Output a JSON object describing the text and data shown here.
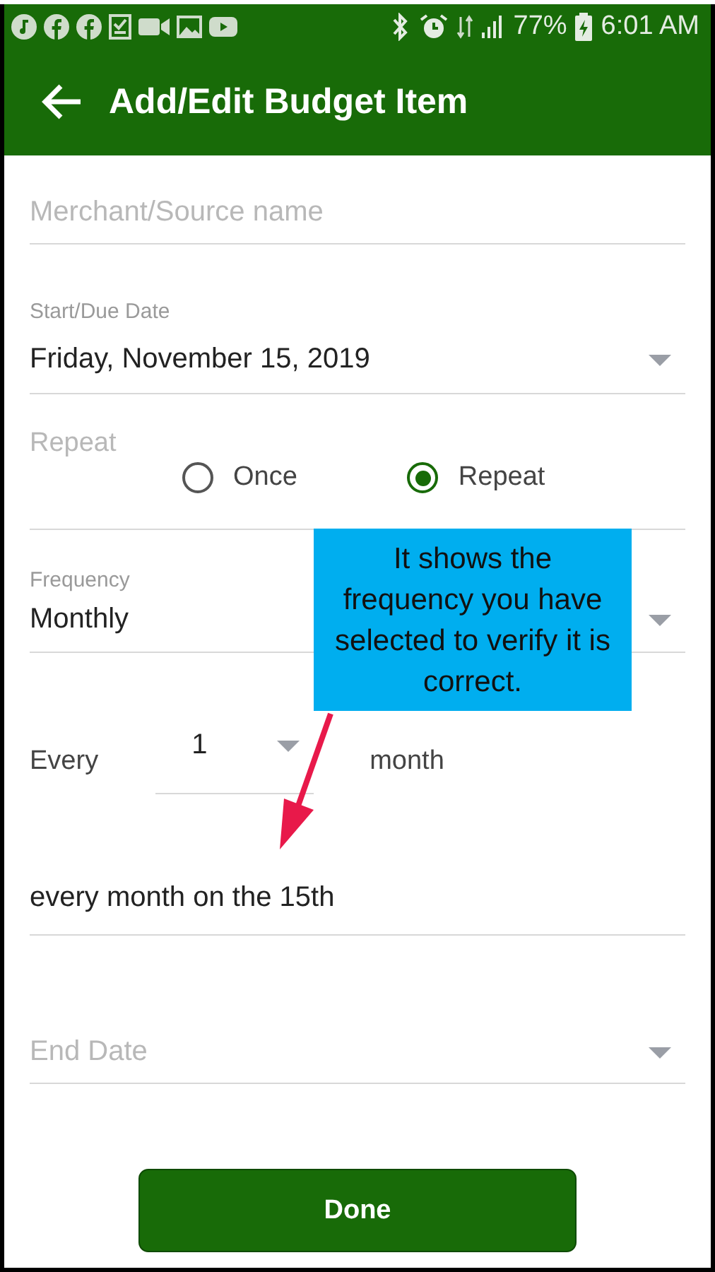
{
  "status_bar": {
    "battery": "77%",
    "time": "6:01 AM"
  },
  "app_bar": {
    "title": "Add/Edit Budget Item"
  },
  "merchant": {
    "placeholder": "Merchant/Source name"
  },
  "start_date": {
    "label": "Start/Due Date",
    "value": "Friday, November 15, 2019"
  },
  "repeat": {
    "label": "Repeat",
    "options": [
      {
        "label": "Once",
        "selected": false
      },
      {
        "label": "Repeat",
        "selected": true
      }
    ]
  },
  "frequency": {
    "label": "Frequency",
    "value": "Monthly"
  },
  "every": {
    "label": "Every",
    "value": "1",
    "unit": "month"
  },
  "summary": {
    "value": "every month on the 15th"
  },
  "end_date": {
    "placeholder": "End Date"
  },
  "done_button": {
    "label": "Done"
  },
  "callout": {
    "text": "It shows the frequency you have selected to verify it is correct."
  }
}
